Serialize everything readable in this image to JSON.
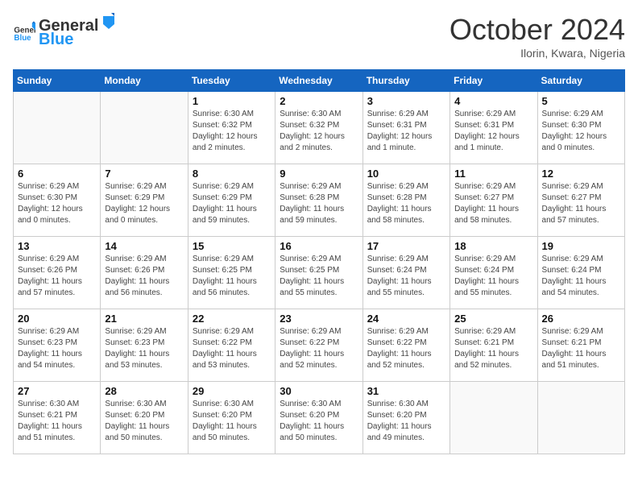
{
  "header": {
    "logo_general": "General",
    "logo_blue": "Blue",
    "month_title": "October 2024",
    "location": "Ilorin, Kwara, Nigeria"
  },
  "days_of_week": [
    "Sunday",
    "Monday",
    "Tuesday",
    "Wednesday",
    "Thursday",
    "Friday",
    "Saturday"
  ],
  "weeks": [
    [
      {
        "day": "",
        "info": ""
      },
      {
        "day": "",
        "info": ""
      },
      {
        "day": "1",
        "info": "Sunrise: 6:30 AM\nSunset: 6:32 PM\nDaylight: 12 hours and 2 minutes."
      },
      {
        "day": "2",
        "info": "Sunrise: 6:30 AM\nSunset: 6:32 PM\nDaylight: 12 hours and 2 minutes."
      },
      {
        "day": "3",
        "info": "Sunrise: 6:29 AM\nSunset: 6:31 PM\nDaylight: 12 hours and 1 minute."
      },
      {
        "day": "4",
        "info": "Sunrise: 6:29 AM\nSunset: 6:31 PM\nDaylight: 12 hours and 1 minute."
      },
      {
        "day": "5",
        "info": "Sunrise: 6:29 AM\nSunset: 6:30 PM\nDaylight: 12 hours and 0 minutes."
      }
    ],
    [
      {
        "day": "6",
        "info": "Sunrise: 6:29 AM\nSunset: 6:30 PM\nDaylight: 12 hours and 0 minutes."
      },
      {
        "day": "7",
        "info": "Sunrise: 6:29 AM\nSunset: 6:29 PM\nDaylight: 12 hours and 0 minutes."
      },
      {
        "day": "8",
        "info": "Sunrise: 6:29 AM\nSunset: 6:29 PM\nDaylight: 11 hours and 59 minutes."
      },
      {
        "day": "9",
        "info": "Sunrise: 6:29 AM\nSunset: 6:28 PM\nDaylight: 11 hours and 59 minutes."
      },
      {
        "day": "10",
        "info": "Sunrise: 6:29 AM\nSunset: 6:28 PM\nDaylight: 11 hours and 58 minutes."
      },
      {
        "day": "11",
        "info": "Sunrise: 6:29 AM\nSunset: 6:27 PM\nDaylight: 11 hours and 58 minutes."
      },
      {
        "day": "12",
        "info": "Sunrise: 6:29 AM\nSunset: 6:27 PM\nDaylight: 11 hours and 57 minutes."
      }
    ],
    [
      {
        "day": "13",
        "info": "Sunrise: 6:29 AM\nSunset: 6:26 PM\nDaylight: 11 hours and 57 minutes."
      },
      {
        "day": "14",
        "info": "Sunrise: 6:29 AM\nSunset: 6:26 PM\nDaylight: 11 hours and 56 minutes."
      },
      {
        "day": "15",
        "info": "Sunrise: 6:29 AM\nSunset: 6:25 PM\nDaylight: 11 hours and 56 minutes."
      },
      {
        "day": "16",
        "info": "Sunrise: 6:29 AM\nSunset: 6:25 PM\nDaylight: 11 hours and 55 minutes."
      },
      {
        "day": "17",
        "info": "Sunrise: 6:29 AM\nSunset: 6:24 PM\nDaylight: 11 hours and 55 minutes."
      },
      {
        "day": "18",
        "info": "Sunrise: 6:29 AM\nSunset: 6:24 PM\nDaylight: 11 hours and 55 minutes."
      },
      {
        "day": "19",
        "info": "Sunrise: 6:29 AM\nSunset: 6:24 PM\nDaylight: 11 hours and 54 minutes."
      }
    ],
    [
      {
        "day": "20",
        "info": "Sunrise: 6:29 AM\nSunset: 6:23 PM\nDaylight: 11 hours and 54 minutes."
      },
      {
        "day": "21",
        "info": "Sunrise: 6:29 AM\nSunset: 6:23 PM\nDaylight: 11 hours and 53 minutes."
      },
      {
        "day": "22",
        "info": "Sunrise: 6:29 AM\nSunset: 6:22 PM\nDaylight: 11 hours and 53 minutes."
      },
      {
        "day": "23",
        "info": "Sunrise: 6:29 AM\nSunset: 6:22 PM\nDaylight: 11 hours and 52 minutes."
      },
      {
        "day": "24",
        "info": "Sunrise: 6:29 AM\nSunset: 6:22 PM\nDaylight: 11 hours and 52 minutes."
      },
      {
        "day": "25",
        "info": "Sunrise: 6:29 AM\nSunset: 6:21 PM\nDaylight: 11 hours and 52 minutes."
      },
      {
        "day": "26",
        "info": "Sunrise: 6:29 AM\nSunset: 6:21 PM\nDaylight: 11 hours and 51 minutes."
      }
    ],
    [
      {
        "day": "27",
        "info": "Sunrise: 6:30 AM\nSunset: 6:21 PM\nDaylight: 11 hours and 51 minutes."
      },
      {
        "day": "28",
        "info": "Sunrise: 6:30 AM\nSunset: 6:20 PM\nDaylight: 11 hours and 50 minutes."
      },
      {
        "day": "29",
        "info": "Sunrise: 6:30 AM\nSunset: 6:20 PM\nDaylight: 11 hours and 50 minutes."
      },
      {
        "day": "30",
        "info": "Sunrise: 6:30 AM\nSunset: 6:20 PM\nDaylight: 11 hours and 50 minutes."
      },
      {
        "day": "31",
        "info": "Sunrise: 6:30 AM\nSunset: 6:20 PM\nDaylight: 11 hours and 49 minutes."
      },
      {
        "day": "",
        "info": ""
      },
      {
        "day": "",
        "info": ""
      }
    ]
  ]
}
